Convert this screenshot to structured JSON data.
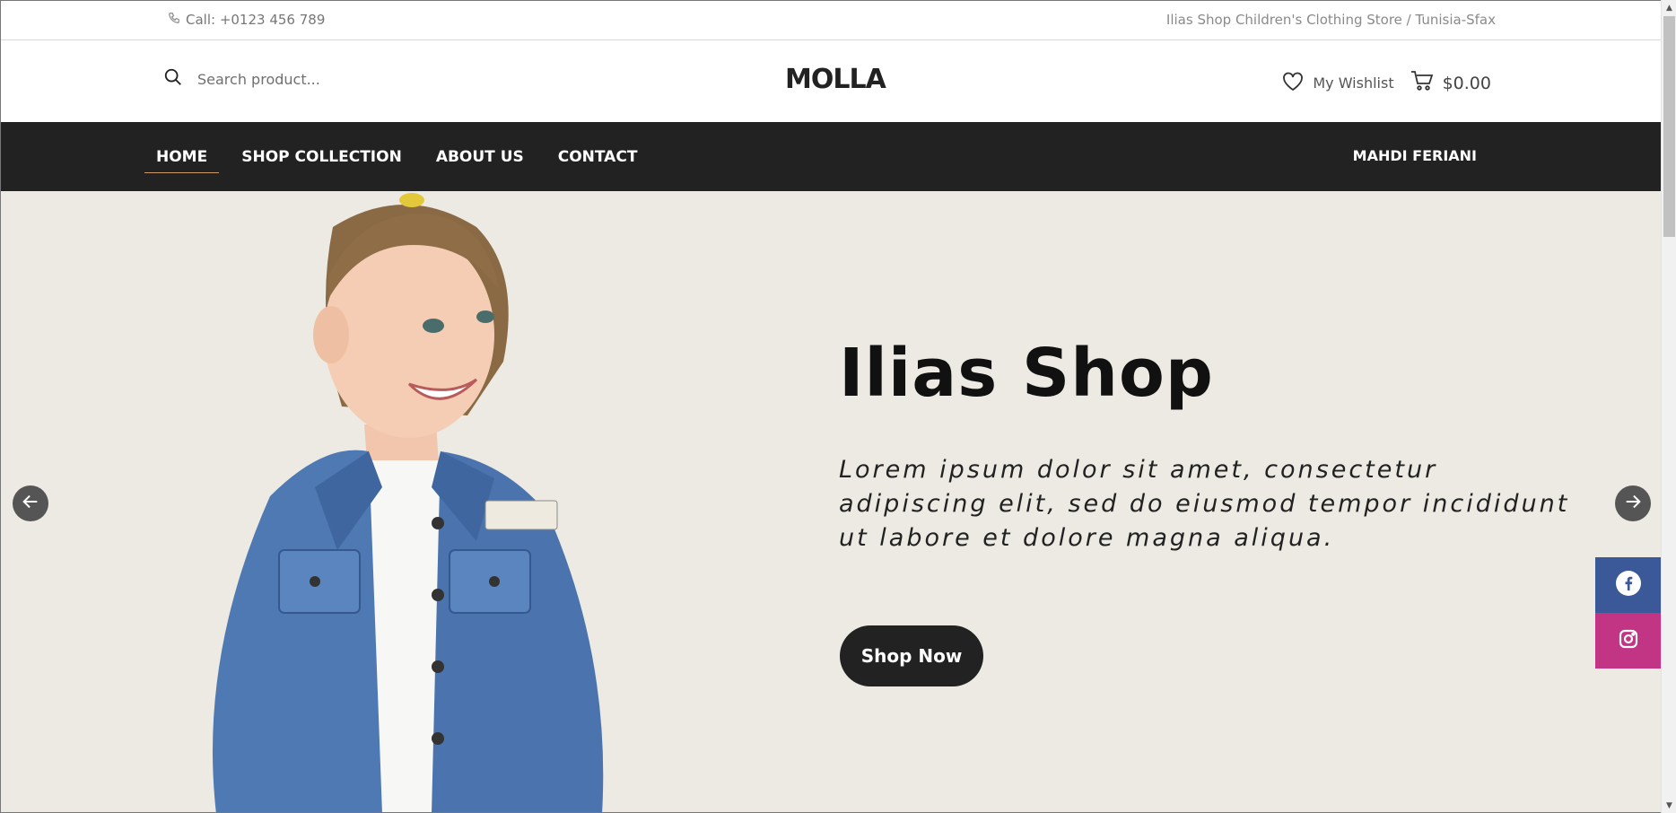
{
  "topbar": {
    "call": "Call: +0123 456 789",
    "tagline": "Ilias Shop Children's Clothing Store / Tunisia-Sfax"
  },
  "header": {
    "search_placeholder": "Search product...",
    "logo": "MOLLA",
    "wishlist": "My Wishlist",
    "cart_total": "$0.00"
  },
  "nav": {
    "items": [
      "HOME",
      "SHOP COLLECTION",
      "ABOUT US",
      "CONTACT"
    ],
    "active": "HOME",
    "user": "MAHDI FERIANI"
  },
  "hero": {
    "title": "Ilias Shop",
    "text": "Lorem ipsum dolor sit amet, consectetur adipiscing elit, sed do eiusmod tempor incididunt ut labore et dolore magna aliqua.",
    "button": "Shop Now"
  },
  "social": [
    "facebook-icon",
    "instagram-icon"
  ],
  "colors": {
    "nav_bg": "#222222",
    "hero_bg": "#eceae3",
    "facebook": "#3b5998",
    "instagram": "#c13584",
    "active_underline": "#cc9966"
  }
}
